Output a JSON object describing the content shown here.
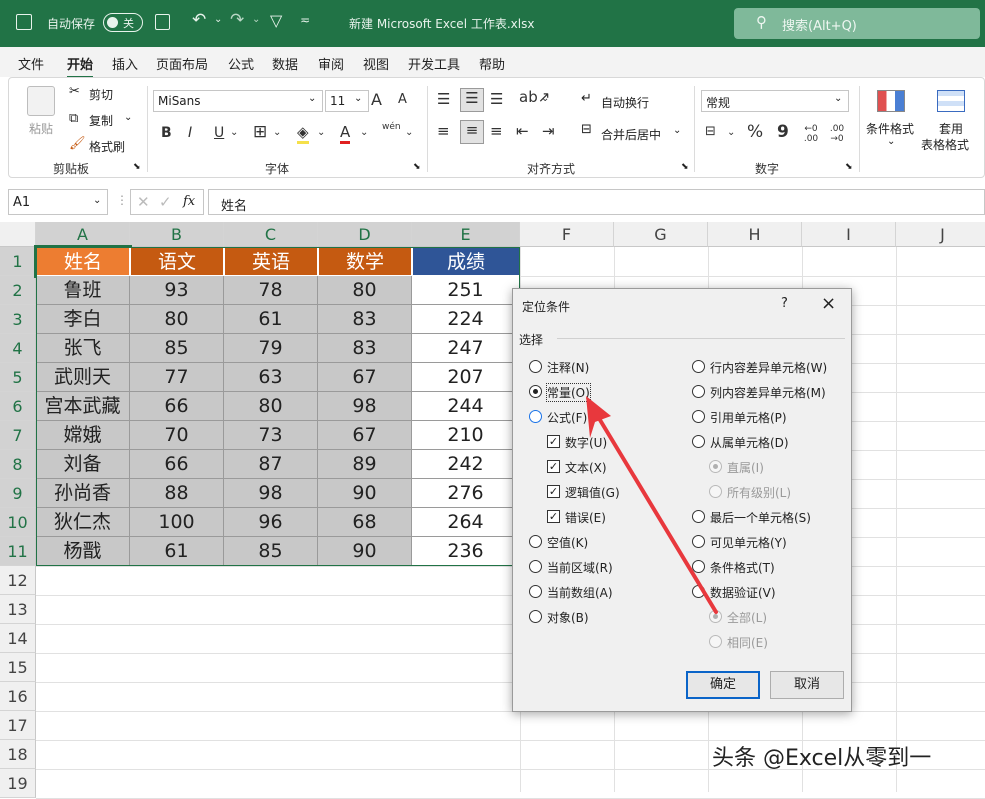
{
  "titlebar": {
    "autosave_label": "自动保存",
    "autosave_state": "关",
    "filename": "新建 Microsoft Excel 工作表.xlsx",
    "search_placeholder": "搜索(Alt+Q)"
  },
  "menu": [
    "文件",
    "开始",
    "插入",
    "页面布局",
    "公式",
    "数据",
    "审阅",
    "视图",
    "开发工具",
    "帮助"
  ],
  "menu_active": "开始",
  "ribbon": {
    "clipboard": {
      "paste": "粘贴",
      "cut": "剪切",
      "copy": "复制",
      "format_painter": "格式刷",
      "label": "剪贴板"
    },
    "font": {
      "name": "MiSans",
      "size": "11",
      "grow": "A",
      "shrink": "A",
      "bold": "B",
      "italic": "I",
      "underline": "U",
      "font_color": "A",
      "wen": "wén",
      "label": "字体"
    },
    "alignment": {
      "wrap": "自动换行",
      "merge": "合并后居中",
      "label": "对齐方式"
    },
    "number": {
      "format": "常规",
      "percent": "%",
      "comma": "9",
      "inc": "←0 .00",
      "dec": ".00 →0",
      "label": "数字"
    },
    "styles": {
      "cond": "条件格式",
      "table1": "套用",
      "table2": "表格格式"
    }
  },
  "formula_bar": {
    "name_box": "A1",
    "fx": "fx",
    "content": "姓名"
  },
  "columns": [
    "A",
    "B",
    "C",
    "D",
    "E",
    "F",
    "G",
    "H",
    "I",
    "J"
  ],
  "rows": [
    "1",
    "2",
    "3",
    "4",
    "5",
    "6",
    "7",
    "8",
    "9",
    "10",
    "11",
    "12",
    "13",
    "14",
    "15",
    "16",
    "17",
    "18",
    "19"
  ],
  "table": {
    "headers": [
      "姓名",
      "语文",
      "英语",
      "数学",
      "成绩"
    ],
    "header_colors": [
      "#ed7d31",
      "#c55a11",
      "#c55a11",
      "#c55a11",
      "#2f5597"
    ],
    "rows": [
      [
        "鲁班",
        "93",
        "78",
        "80",
        "251"
      ],
      [
        "李白",
        "80",
        "61",
        "83",
        "224"
      ],
      [
        "张飞",
        "85",
        "79",
        "83",
        "247"
      ],
      [
        "武则天",
        "77",
        "63",
        "67",
        "207"
      ],
      [
        "宫本武藏",
        "66",
        "80",
        "98",
        "244"
      ],
      [
        "嫦娥",
        "70",
        "73",
        "67",
        "210"
      ],
      [
        "刘备",
        "66",
        "87",
        "89",
        "242"
      ],
      [
        "孙尚香",
        "88",
        "98",
        "90",
        "276"
      ],
      [
        "狄仁杰",
        "100",
        "96",
        "68",
        "264"
      ],
      [
        "杨戬",
        "61",
        "85",
        "90",
        "236"
      ]
    ]
  },
  "dialog": {
    "title": "定位条件",
    "help": "?",
    "close": "×",
    "section": "选择",
    "left": [
      {
        "label": "注释(N)",
        "kind": "radio",
        "state": "off"
      },
      {
        "label": "常量(O)",
        "kind": "radio",
        "state": "on"
      },
      {
        "label": "公式(F)",
        "kind": "radio",
        "state": "blue"
      },
      {
        "label": "数字(U)",
        "kind": "check",
        "state": "on"
      },
      {
        "label": "文本(X)",
        "kind": "check",
        "state": "on"
      },
      {
        "label": "逻辑值(G)",
        "kind": "check",
        "state": "on"
      },
      {
        "label": "错误(E)",
        "kind": "check",
        "state": "on"
      },
      {
        "label": "空值(K)",
        "kind": "radio",
        "state": "off"
      },
      {
        "label": "当前区域(R)",
        "kind": "radio",
        "state": "off"
      },
      {
        "label": "当前数组(A)",
        "kind": "radio",
        "state": "off"
      },
      {
        "label": "对象(B)",
        "kind": "radio",
        "state": "off"
      }
    ],
    "right": [
      {
        "label": "行内容差异单元格(W)",
        "kind": "radio",
        "state": "off"
      },
      {
        "label": "列内容差异单元格(M)",
        "kind": "radio",
        "state": "off"
      },
      {
        "label": "引用单元格(P)",
        "kind": "radio",
        "state": "off"
      },
      {
        "label": "从属单元格(D)",
        "kind": "radio",
        "state": "off"
      },
      {
        "label": "直属(I)",
        "kind": "radio",
        "state": "dis-on"
      },
      {
        "label": "所有级别(L)",
        "kind": "radio",
        "state": "dis"
      },
      {
        "label": "最后一个单元格(S)",
        "kind": "radio",
        "state": "off"
      },
      {
        "label": "可见单元格(Y)",
        "kind": "radio",
        "state": "off"
      },
      {
        "label": "条件格式(T)",
        "kind": "radio",
        "state": "off"
      },
      {
        "label": "数据验证(V)",
        "kind": "radio",
        "state": "off"
      },
      {
        "label": "全部(L)",
        "kind": "radio",
        "state": "dis-on"
      },
      {
        "label": "相同(E)",
        "kind": "radio",
        "state": "dis"
      }
    ],
    "ok": "确定",
    "cancel": "取消"
  },
  "watermark": "头条 @Excel从零到一",
  "colors": {
    "title_green": "#217346",
    "arrow_red": "#e8383d",
    "cell_gray": "#c8c8c8"
  }
}
